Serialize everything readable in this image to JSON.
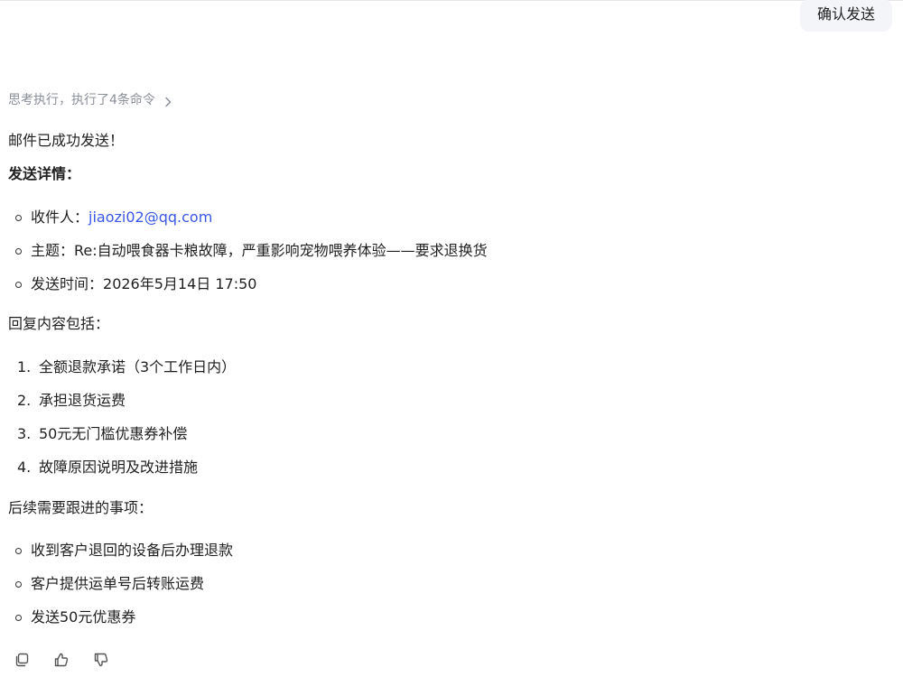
{
  "user_message": {
    "text": "确认发送"
  },
  "thinking": {
    "summary": "思考执行，执行了4条命令"
  },
  "reply": {
    "success_text": "邮件已成功发送！",
    "details_title": "发送详情：",
    "details": [
      {
        "label": "收件人：",
        "value": "jiaozi02@qq.com",
        "is_link": true
      },
      {
        "label": "主题：",
        "value": "Re:自动喂食器卡粮故障，严重影响宠物喂养体验——要求退换货",
        "is_link": false
      },
      {
        "label": "发送时间：",
        "value": "2026年5月14日 17:50",
        "is_link": false
      }
    ],
    "content_title": "回复内容包括：",
    "content_items": [
      {
        "num": "1.",
        "text": "全额退款承诺（3个工作日内）"
      },
      {
        "num": "2.",
        "text": "承担退货运费"
      },
      {
        "num": "3.",
        "text": "50元无门槛优惠券补偿"
      },
      {
        "num": "4.",
        "text": "故障原因说明及改进措施"
      }
    ],
    "followup_title": "后续需要跟进的事项：",
    "followup_items": [
      {
        "text": "收到客户退回的设备后办理退款"
      },
      {
        "text": "客户提供运单号后转账运费"
      },
      {
        "text": "发送50元优惠券"
      }
    ]
  },
  "actions": {
    "icons": [
      "copy-icon",
      "thumbs-up-icon",
      "thumbs-down-icon"
    ]
  },
  "colors": {
    "link": "#3a57e8",
    "muted": "#8a8f98",
    "bubble_bg": "#f4f5f8",
    "text": "#1f1f1f"
  }
}
